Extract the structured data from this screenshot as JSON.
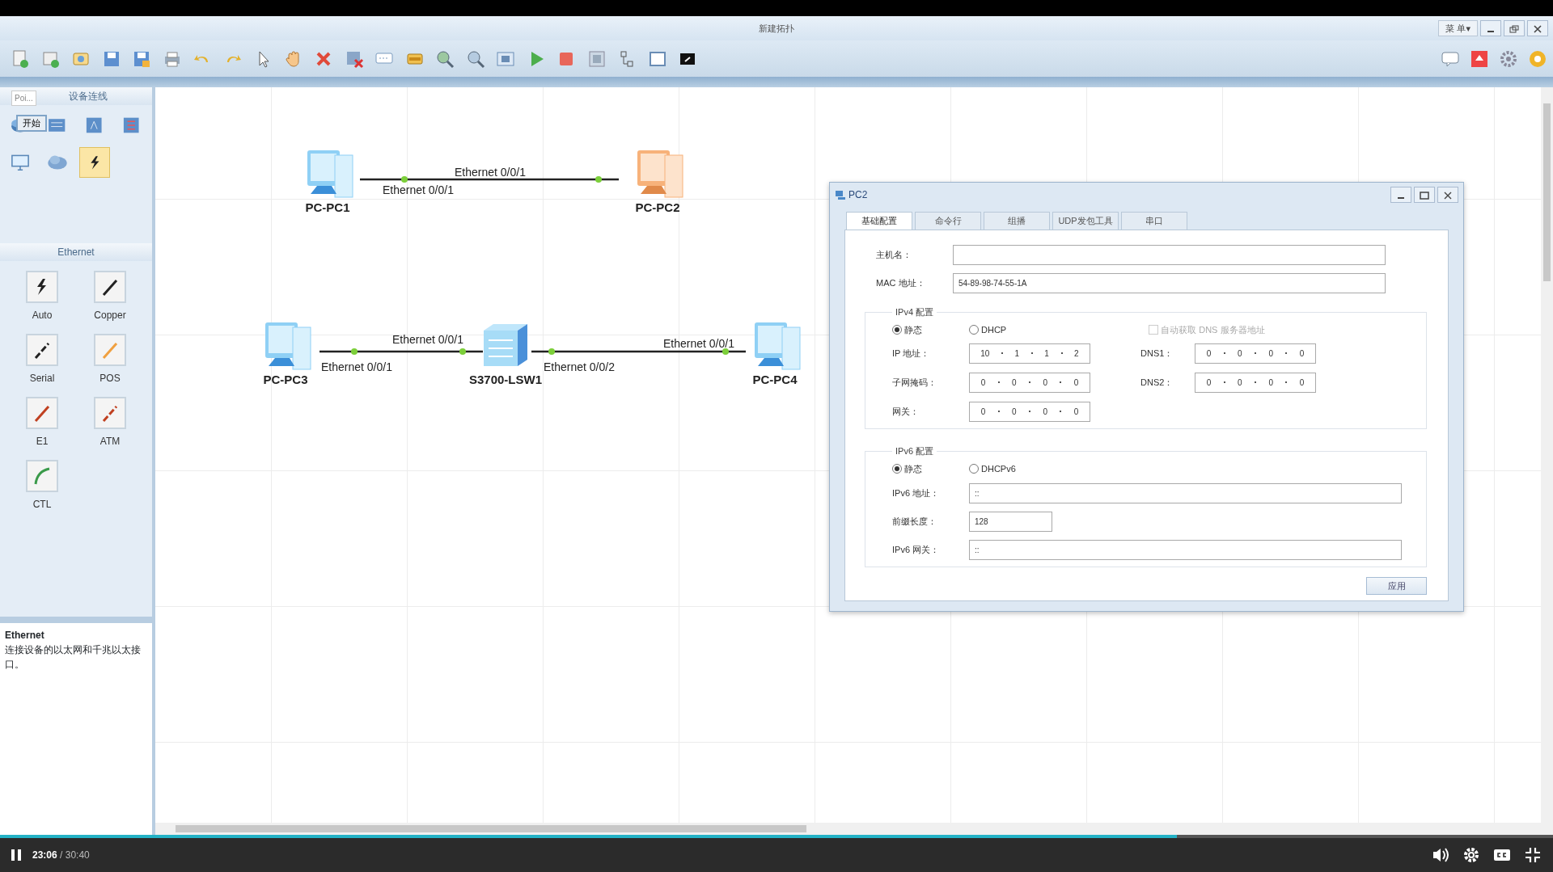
{
  "window": {
    "title": "新建拓扑",
    "menu_button": "菜 单▾"
  },
  "device_panel": {
    "header": "设备连线",
    "tooltip": "Poi...",
    "tooltip_button": "开始",
    "devices": [
      {
        "kind": "router",
        "selected": false
      },
      {
        "kind": "switch",
        "selected": false
      },
      {
        "kind": "wlan",
        "selected": false
      },
      {
        "kind": "firewall",
        "selected": false
      },
      {
        "kind": "pc",
        "selected": false
      },
      {
        "kind": "cloud",
        "selected": false
      },
      {
        "kind": "cable",
        "selected": true
      }
    ]
  },
  "cable_panel": {
    "header": "Ethernet",
    "cables": [
      {
        "kind": "auto",
        "label": "Auto"
      },
      {
        "kind": "copper",
        "label": "Copper"
      },
      {
        "kind": "serial",
        "label": "Serial"
      },
      {
        "kind": "pos",
        "label": "POS"
      },
      {
        "kind": "e1",
        "label": "E1"
      },
      {
        "kind": "atm",
        "label": "ATM"
      },
      {
        "kind": "ctl",
        "label": "CTL"
      }
    ]
  },
  "info_panel": {
    "title": "Ethernet",
    "text": "连接设备的以太网和千兆以太接口。"
  },
  "topology": {
    "nodes": [
      {
        "kind": "pc",
        "label": "PC-PC1",
        "selected": false
      },
      {
        "kind": "pc",
        "label": "PC-PC2",
        "selected": true
      },
      {
        "kind": "pc",
        "label": "PC-PC3",
        "selected": false
      },
      {
        "kind": "switch",
        "label": "S3700-LSW1",
        "selected": false
      },
      {
        "kind": "pc",
        "label": "PC-PC4",
        "selected": false
      }
    ],
    "links": [
      {
        "ports": [
          "Ethernet 0/0/1",
          "Ethernet 0/0/1"
        ]
      },
      {
        "ports": [
          "Ethernet 0/0/1",
          "Ethernet 0/0/1"
        ]
      },
      {
        "ports": [
          "Ethernet 0/0/2",
          "Ethernet 0/0/1"
        ]
      }
    ]
  },
  "dialog": {
    "title": "PC2",
    "tabs": [
      {
        "label": "基础配置",
        "selected": true
      },
      {
        "label": "命令行",
        "selected": false
      },
      {
        "label": "组播",
        "selected": false
      },
      {
        "label": "UDP发包工具",
        "selected": false
      },
      {
        "label": "串口",
        "selected": false
      }
    ],
    "hostname": {
      "label": "主机名："
    },
    "mac": {
      "label": "MAC 地址：",
      "value": "54-89-98-74-55-1A"
    },
    "ipv4": {
      "title": "IPv4 配置",
      "modes": [
        {
          "label": "静态",
          "selected": true
        },
        {
          "label": "DHCP",
          "selected": false
        }
      ],
      "auto_dns": {
        "label": "自动获取 DNS 服务器地址",
        "checked": false,
        "disabled": true
      },
      "ip": {
        "label": "IP 地址：",
        "octets": [
          "10",
          "1",
          "1",
          "2"
        ]
      },
      "mask": {
        "label": "子网掩码：",
        "octets": [
          "0",
          "0",
          "0",
          "0"
        ]
      },
      "gateway": {
        "label": "网关：",
        "octets": [
          "0",
          "0",
          "0",
          "0"
        ]
      },
      "dns1": {
        "label": "DNS1：",
        "octets": [
          "0",
          "0",
          "0",
          "0"
        ]
      },
      "dns2": {
        "label": "DNS2：",
        "octets": [
          "0",
          "0",
          "0",
          "0"
        ]
      }
    },
    "ipv6": {
      "title": "IPv6 配置",
      "modes": [
        {
          "label": "静态",
          "selected": true
        },
        {
          "label": "DHCPv6",
          "selected": false
        }
      ],
      "address": {
        "label": "IPv6 地址：",
        "value": "::"
      },
      "prefix": {
        "label": "前缀长度：",
        "value": "128"
      },
      "gateway": {
        "label": "IPv6 网关：",
        "value": "::"
      }
    },
    "apply_button": "应用"
  },
  "player": {
    "time": "**23:06** / 30:40",
    "level": 0.758
  }
}
